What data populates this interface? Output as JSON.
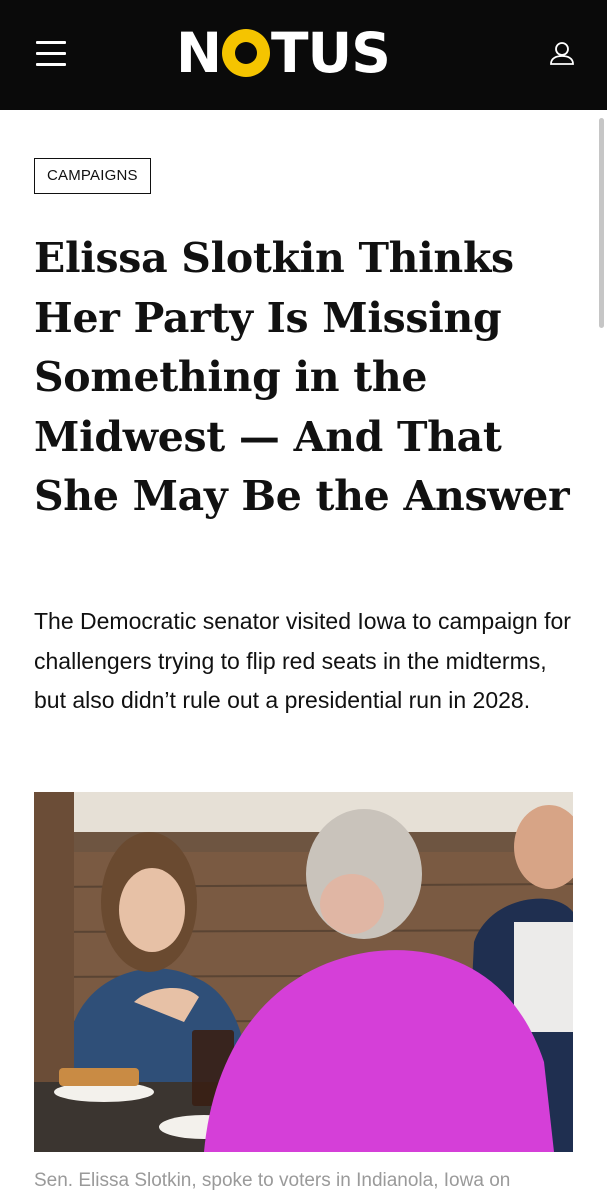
{
  "header": {
    "logo": {
      "left": "N",
      "right": "TUS"
    },
    "menu_icon": "hamburger-menu-icon",
    "account_icon": "user-icon"
  },
  "article": {
    "category": "CAMPAIGNS",
    "headline": "Elissa Slotkin Thinks Her Party Is Missing Something in the Midwest — And That She May Be the Answer",
    "dek": "The Democratic senator visited Iowa to campaign for challengers trying to flip red seats in the midterms, but also didn’t rule out a presidential run in 2028.",
    "caption": "Sen. Elissa Slotkin, spoke to voters in Indianola, Iowa on"
  },
  "colors": {
    "header_bg": "#0a0a0a",
    "logo_accent": "#f5c400",
    "caption_text": "#9a9a9a"
  }
}
